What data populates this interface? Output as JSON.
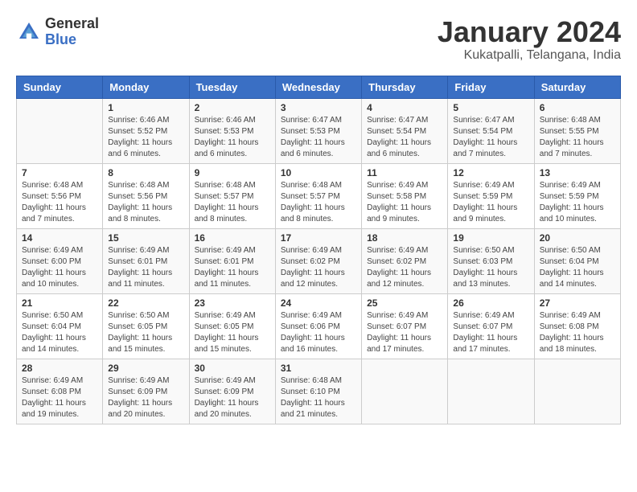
{
  "logo": {
    "general": "General",
    "blue": "Blue"
  },
  "title": "January 2024",
  "location": "Kukatpalli, Telangana, India",
  "days_of_week": [
    "Sunday",
    "Monday",
    "Tuesday",
    "Wednesday",
    "Thursday",
    "Friday",
    "Saturday"
  ],
  "weeks": [
    [
      {
        "day": "",
        "info": ""
      },
      {
        "day": "1",
        "info": "Sunrise: 6:46 AM\nSunset: 5:52 PM\nDaylight: 11 hours and 6 minutes."
      },
      {
        "day": "2",
        "info": "Sunrise: 6:46 AM\nSunset: 5:53 PM\nDaylight: 11 hours and 6 minutes."
      },
      {
        "day": "3",
        "info": "Sunrise: 6:47 AM\nSunset: 5:53 PM\nDaylight: 11 hours and 6 minutes."
      },
      {
        "day": "4",
        "info": "Sunrise: 6:47 AM\nSunset: 5:54 PM\nDaylight: 11 hours and 6 minutes."
      },
      {
        "day": "5",
        "info": "Sunrise: 6:47 AM\nSunset: 5:54 PM\nDaylight: 11 hours and 7 minutes."
      },
      {
        "day": "6",
        "info": "Sunrise: 6:48 AM\nSunset: 5:55 PM\nDaylight: 11 hours and 7 minutes."
      }
    ],
    [
      {
        "day": "7",
        "info": "Sunrise: 6:48 AM\nSunset: 5:56 PM\nDaylight: 11 hours and 7 minutes."
      },
      {
        "day": "8",
        "info": "Sunrise: 6:48 AM\nSunset: 5:56 PM\nDaylight: 11 hours and 8 minutes."
      },
      {
        "day": "9",
        "info": "Sunrise: 6:48 AM\nSunset: 5:57 PM\nDaylight: 11 hours and 8 minutes."
      },
      {
        "day": "10",
        "info": "Sunrise: 6:48 AM\nSunset: 5:57 PM\nDaylight: 11 hours and 8 minutes."
      },
      {
        "day": "11",
        "info": "Sunrise: 6:49 AM\nSunset: 5:58 PM\nDaylight: 11 hours and 9 minutes."
      },
      {
        "day": "12",
        "info": "Sunrise: 6:49 AM\nSunset: 5:59 PM\nDaylight: 11 hours and 9 minutes."
      },
      {
        "day": "13",
        "info": "Sunrise: 6:49 AM\nSunset: 5:59 PM\nDaylight: 11 hours and 10 minutes."
      }
    ],
    [
      {
        "day": "14",
        "info": "Sunrise: 6:49 AM\nSunset: 6:00 PM\nDaylight: 11 hours and 10 minutes."
      },
      {
        "day": "15",
        "info": "Sunrise: 6:49 AM\nSunset: 6:01 PM\nDaylight: 11 hours and 11 minutes."
      },
      {
        "day": "16",
        "info": "Sunrise: 6:49 AM\nSunset: 6:01 PM\nDaylight: 11 hours and 11 minutes."
      },
      {
        "day": "17",
        "info": "Sunrise: 6:49 AM\nSunset: 6:02 PM\nDaylight: 11 hours and 12 minutes."
      },
      {
        "day": "18",
        "info": "Sunrise: 6:49 AM\nSunset: 6:02 PM\nDaylight: 11 hours and 12 minutes."
      },
      {
        "day": "19",
        "info": "Sunrise: 6:50 AM\nSunset: 6:03 PM\nDaylight: 11 hours and 13 minutes."
      },
      {
        "day": "20",
        "info": "Sunrise: 6:50 AM\nSunset: 6:04 PM\nDaylight: 11 hours and 14 minutes."
      }
    ],
    [
      {
        "day": "21",
        "info": "Sunrise: 6:50 AM\nSunset: 6:04 PM\nDaylight: 11 hours and 14 minutes."
      },
      {
        "day": "22",
        "info": "Sunrise: 6:50 AM\nSunset: 6:05 PM\nDaylight: 11 hours and 15 minutes."
      },
      {
        "day": "23",
        "info": "Sunrise: 6:49 AM\nSunset: 6:05 PM\nDaylight: 11 hours and 15 minutes."
      },
      {
        "day": "24",
        "info": "Sunrise: 6:49 AM\nSunset: 6:06 PM\nDaylight: 11 hours and 16 minutes."
      },
      {
        "day": "25",
        "info": "Sunrise: 6:49 AM\nSunset: 6:07 PM\nDaylight: 11 hours and 17 minutes."
      },
      {
        "day": "26",
        "info": "Sunrise: 6:49 AM\nSunset: 6:07 PM\nDaylight: 11 hours and 17 minutes."
      },
      {
        "day": "27",
        "info": "Sunrise: 6:49 AM\nSunset: 6:08 PM\nDaylight: 11 hours and 18 minutes."
      }
    ],
    [
      {
        "day": "28",
        "info": "Sunrise: 6:49 AM\nSunset: 6:08 PM\nDaylight: 11 hours and 19 minutes."
      },
      {
        "day": "29",
        "info": "Sunrise: 6:49 AM\nSunset: 6:09 PM\nDaylight: 11 hours and 20 minutes."
      },
      {
        "day": "30",
        "info": "Sunrise: 6:49 AM\nSunset: 6:09 PM\nDaylight: 11 hours and 20 minutes."
      },
      {
        "day": "31",
        "info": "Sunrise: 6:48 AM\nSunset: 6:10 PM\nDaylight: 11 hours and 21 minutes."
      },
      {
        "day": "",
        "info": ""
      },
      {
        "day": "",
        "info": ""
      },
      {
        "day": "",
        "info": ""
      }
    ]
  ]
}
